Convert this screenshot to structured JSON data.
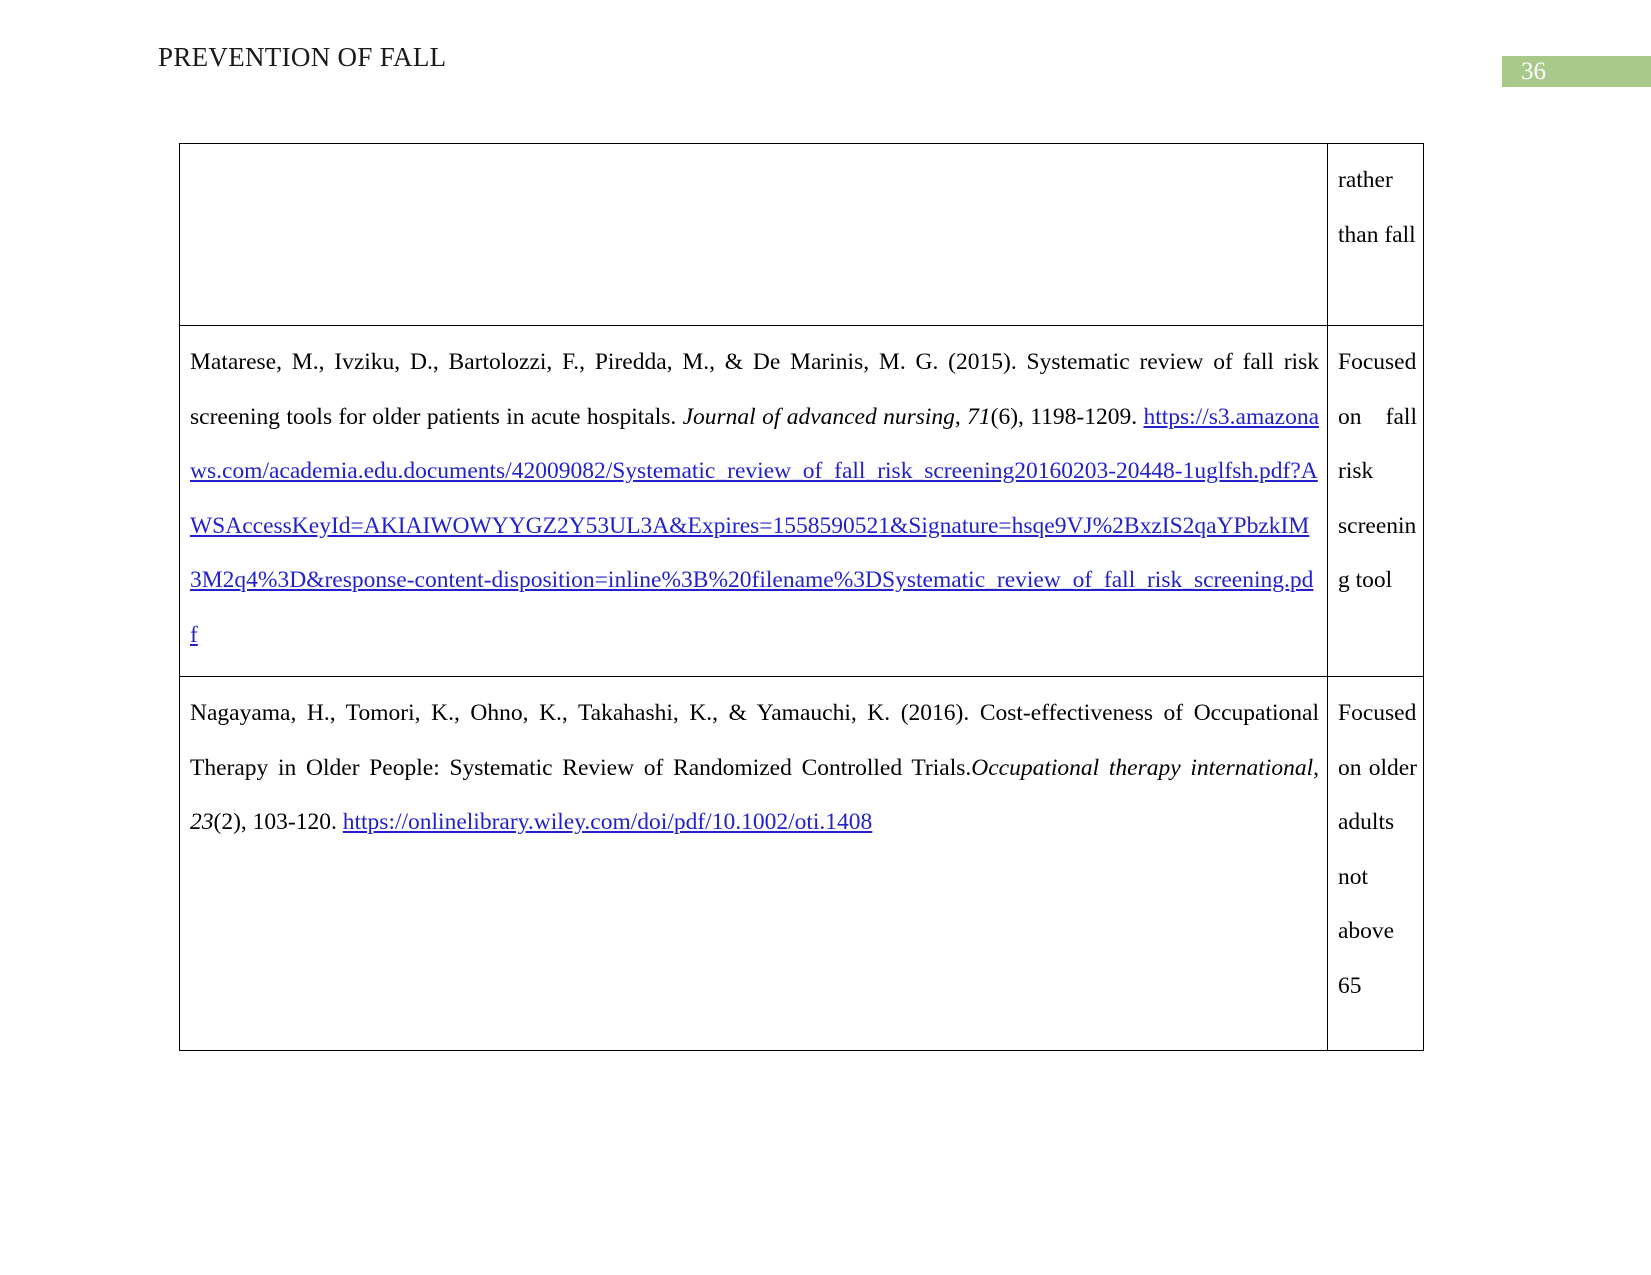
{
  "header": {
    "running_head": "PREVENTION OF FALL",
    "page_number": "36",
    "banner_color": "#a9c98a"
  },
  "colors": {
    "link": "#2222cc",
    "text": "#000000",
    "banner": "#a9c98a",
    "border": "#000000"
  },
  "table": {
    "rows": [
      {
        "citation_plain": "",
        "note": "rather than fall"
      },
      {
        "citation_part1": "Matarese, M., Ivziku, D., Bartolozzi, F., Piredda, M., & De Marinis, M. G. (2015). Systematic review of fall risk screening tools for older patients in acute hospitals. ",
        "citation_italic1": "Journal of advanced nursing",
        "citation_part2": ", ",
        "citation_italic2": "71",
        "citation_part3": "(6), 1198-1209. ",
        "link_text": "https://s3.amazonaws.com/academia.edu.documents/42009082/Systematic_review_of_fall_risk_screening20160203-20448-1uglfsh.pdf?AWSAccessKeyId=AKIAIWOWYYGZ2Y53UL3A&Expires=1558590521&Signature=hsqe9VJ%2BxzIS2qaYPbzkIM3M2q4%3D&response-content-disposition=inline%3B%20filename%3DSystematic_review_of_fall_risk_screening.pdf",
        "note": "Focused on fall risk screening tool"
      },
      {
        "citation_part1": "Nagayama, H., Tomori, K., Ohno, K., Takahashi, K., & Yamauchi, K. (2016). Cost-effectiveness of Occupational Therapy in Older People: Systematic Review of Randomized Controlled Trials.",
        "citation_italic1": "Occupational therapy international",
        "citation_part2": ", ",
        "citation_italic2": "23",
        "citation_part3": "(2), 103-120. ",
        "link_text": "https://onlinelibrary.wiley.com/doi/pdf/10.1002/oti.1408",
        "note": "Focused on older adults not above 65"
      }
    ]
  }
}
